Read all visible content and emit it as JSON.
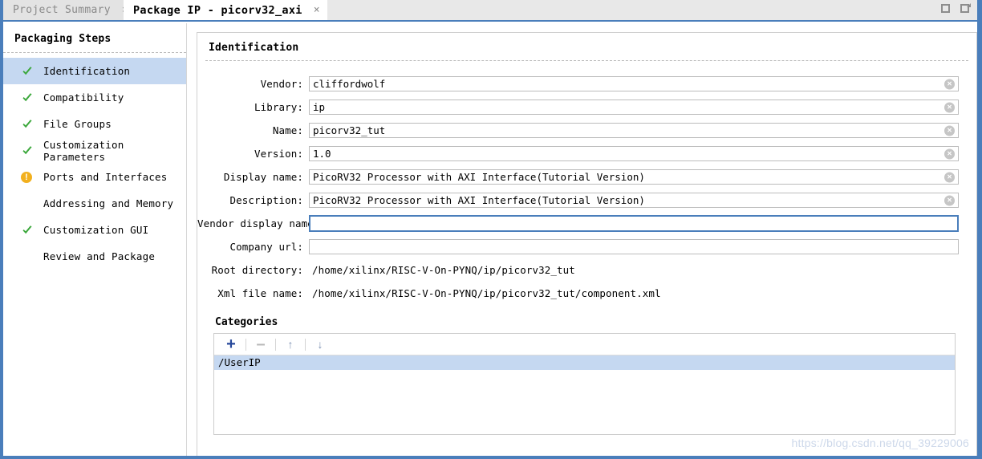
{
  "window": {
    "controls": [
      {
        "name": "maximize-button",
        "icon": "square-icon"
      },
      {
        "name": "float-button",
        "icon": "restore-icon"
      }
    ]
  },
  "tabs": [
    {
      "label": "Project Summary",
      "active": false,
      "close": "×"
    },
    {
      "label": "Package IP - picorv32_axi",
      "active": true,
      "close": "×"
    }
  ],
  "sidebar": {
    "title": "Packaging Steps",
    "items": [
      {
        "label": "Identification",
        "status": "check",
        "selected": true
      },
      {
        "label": "Compatibility",
        "status": "check",
        "selected": false
      },
      {
        "label": "File Groups",
        "status": "check",
        "selected": false
      },
      {
        "label": "Customization Parameters",
        "status": "check",
        "selected": false
      },
      {
        "label": "Ports and Interfaces",
        "status": "warning",
        "selected": false
      },
      {
        "label": "Addressing and Memory",
        "status": "none",
        "selected": false
      },
      {
        "label": "Customization GUI",
        "status": "check",
        "selected": false
      },
      {
        "label": "Review and Package",
        "status": "none",
        "selected": false
      }
    ]
  },
  "main": {
    "title": "Identification",
    "fields": [
      {
        "label": "Vendor:",
        "value": "cliffordwolf",
        "type": "input",
        "clearable": true,
        "focused": false
      },
      {
        "label": "Library:",
        "value": "ip",
        "type": "input",
        "clearable": true,
        "focused": false
      },
      {
        "label": "Name:",
        "value": "picorv32_tut",
        "type": "input",
        "clearable": true,
        "focused": false
      },
      {
        "label": "Version:",
        "value": "1.0",
        "type": "input",
        "clearable": true,
        "focused": false
      },
      {
        "label": "Display name:",
        "value": "PicoRV32 Processor with AXI Interface(Tutorial Version)",
        "type": "input",
        "clearable": true,
        "focused": false
      },
      {
        "label": "Description:",
        "value": "PicoRV32 Processor with AXI Interface(Tutorial Version)",
        "type": "input",
        "clearable": true,
        "focused": false
      },
      {
        "label": "Vendor display name:",
        "value": "",
        "type": "input",
        "clearable": false,
        "focused": true
      },
      {
        "label": "Company url:",
        "value": "",
        "type": "input",
        "clearable": false,
        "focused": false
      },
      {
        "label": "Root directory:",
        "value": "/home/xilinx/RISC-V-On-PYNQ/ip/picorv32_tut",
        "type": "static",
        "clearable": false,
        "focused": false
      },
      {
        "label": "Xml file name:",
        "value": "/home/xilinx/RISC-V-On-PYNQ/ip/picorv32_tut/component.xml",
        "type": "static",
        "clearable": false,
        "focused": false
      }
    ],
    "categories": {
      "title": "Categories",
      "toolbar": [
        {
          "name": "add-category-button",
          "glyph": "+",
          "style": "tb-plus",
          "enabled": true
        },
        {
          "name": "remove-category-button",
          "glyph": "–",
          "style": "tb-minus",
          "enabled": false
        },
        {
          "name": "move-up-button",
          "glyph": "↑",
          "style": "tb-arrow",
          "enabled": false
        },
        {
          "name": "move-down-button",
          "glyph": "↓",
          "style": "tb-arrow",
          "enabled": false
        }
      ],
      "items": [
        {
          "label": "/UserIP",
          "selected": true
        }
      ]
    }
  },
  "watermark": "https://blog.csdn.net/qq_39229006",
  "colors": {
    "frame_blue": "#4a7ebb",
    "selection_blue": "#c5d8f1",
    "check_green": "#3ca83c",
    "warning_amber": "#f2b01e"
  }
}
